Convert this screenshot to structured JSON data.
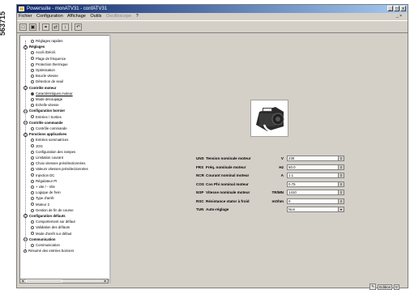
{
  "side_number": "563715",
  "window": {
    "title": "Powersuite - monATV31 - confATV31",
    "controls": [
      "_",
      "□",
      "x"
    ]
  },
  "menu": {
    "items": [
      "Fichier",
      "Configuration",
      "Affichage",
      "Outils",
      "Oscilloscope",
      "?"
    ],
    "disabled_index": 4,
    "mdi_controls": "_ ×"
  },
  "toolbar": {
    "buttons": [
      "new-icon",
      "open-icon",
      "connect-icon",
      "transfer-icon",
      "compare-icon",
      "undo-icon"
    ],
    "glyphs": [
      "□",
      "▣",
      "⚭",
      "⇄",
      "↕",
      "↶"
    ]
  },
  "tree": {
    "items": [
      {
        "label": "Réglages rapides",
        "level": 1,
        "group": false
      },
      {
        "label": "Réglages",
        "level": 0,
        "group": true
      },
      {
        "label": "Accél./Décél.",
        "level": 1,
        "group": false
      },
      {
        "label": "Plage de fréquence",
        "level": 1,
        "group": false
      },
      {
        "label": "Protection thermique",
        "level": 1,
        "group": false
      },
      {
        "label": "Optimisation",
        "level": 1,
        "group": false
      },
      {
        "label": "Boucle vitesse",
        "level": 1,
        "group": false
      },
      {
        "label": "Détection de seuil",
        "level": 1,
        "group": false
      },
      {
        "label": "Contrôle moteur",
        "level": 0,
        "group": true
      },
      {
        "label": "Caractéristiques moteur",
        "level": 1,
        "group": false,
        "selected": true
      },
      {
        "label": "Mode découpage",
        "level": 1,
        "group": false
      },
      {
        "label": "Echelle vitesse",
        "level": 1,
        "group": false
      },
      {
        "label": "Configuration bornier",
        "level": 0,
        "group": true
      },
      {
        "label": "Entrées / Sorties",
        "level": 1,
        "group": false
      },
      {
        "label": "Contrôle commande",
        "level": 0,
        "group": true
      },
      {
        "label": "Contrôle commande",
        "level": 1,
        "group": false
      },
      {
        "label": "Fonctions applicatives",
        "level": 0,
        "group": true
      },
      {
        "label": "Entrées sommatrices",
        "level": 1,
        "group": false
      },
      {
        "label": "JOG",
        "level": 1,
        "group": false
      },
      {
        "label": "Configuration des rampes",
        "level": 1,
        "group": false
      },
      {
        "label": "Limitation courant",
        "level": 1,
        "group": false
      },
      {
        "label": "Choix vitesses présélectionnées",
        "level": 1,
        "group": false
      },
      {
        "label": "Valeurs vitesses présélectionnées",
        "level": 1,
        "group": false
      },
      {
        "label": "Injection DC",
        "level": 1,
        "group": false
      },
      {
        "label": "Régulateur PI",
        "level": 1,
        "group": false
      },
      {
        "label": "+ vite / - Vite",
        "level": 1,
        "group": false
      },
      {
        "label": "Logique de frein",
        "level": 1,
        "group": false
      },
      {
        "label": "Type d'arrêt",
        "level": 1,
        "group": false
      },
      {
        "label": "Moteur 2",
        "level": 1,
        "group": false
      },
      {
        "label": "Gestion de fin de course",
        "level": 1,
        "group": false
      },
      {
        "label": "Configuration défauts",
        "level": 0,
        "group": true
      },
      {
        "label": "Comportement sur défaut",
        "level": 1,
        "group": false
      },
      {
        "label": "Validation des défauts",
        "level": 1,
        "group": false
      },
      {
        "label": "Mode d'arrêt sur défaut",
        "level": 1,
        "group": false
      },
      {
        "label": "Communication",
        "level": 0,
        "group": true
      },
      {
        "label": "Communication",
        "level": 1,
        "group": false
      },
      {
        "label": "Résumé des entrées borniers",
        "level": 0,
        "group": false
      }
    ]
  },
  "params": [
    {
      "code": "UNS",
      "name": "Tension nominale moteur",
      "unit": "V",
      "value": "230",
      "spin": true
    },
    {
      "code": "FRS",
      "name": "Fréq. nominale moteur",
      "unit": "Hz",
      "value": "50.0",
      "spin": true
    },
    {
      "code": "NCR",
      "name": "Courant nominal moteur",
      "unit": "A",
      "value": "1.1",
      "spin": true
    },
    {
      "code": "COS",
      "name": "Cos Phi nominal moteur",
      "unit": "",
      "value": "0.75",
      "spin": true
    },
    {
      "code": "NSP",
      "name": "Vitesse nominale moteur",
      "unit": "TR/MN",
      "value": "1410",
      "spin": true
    },
    {
      "code": "RSC",
      "name": "Résistance stator à froid",
      "unit": "mOhm",
      "value": "0",
      "spin": true
    },
    {
      "code": "TUN",
      "name": "Auto-réglage",
      "unit": "",
      "value": "Non",
      "spin": false
    }
  ],
  "status": {
    "edit_label": "Edition",
    "mode_label": "tr"
  },
  "colors": {
    "titlebar": "#0a246a",
    "window_bg": "#d4d0c8"
  }
}
